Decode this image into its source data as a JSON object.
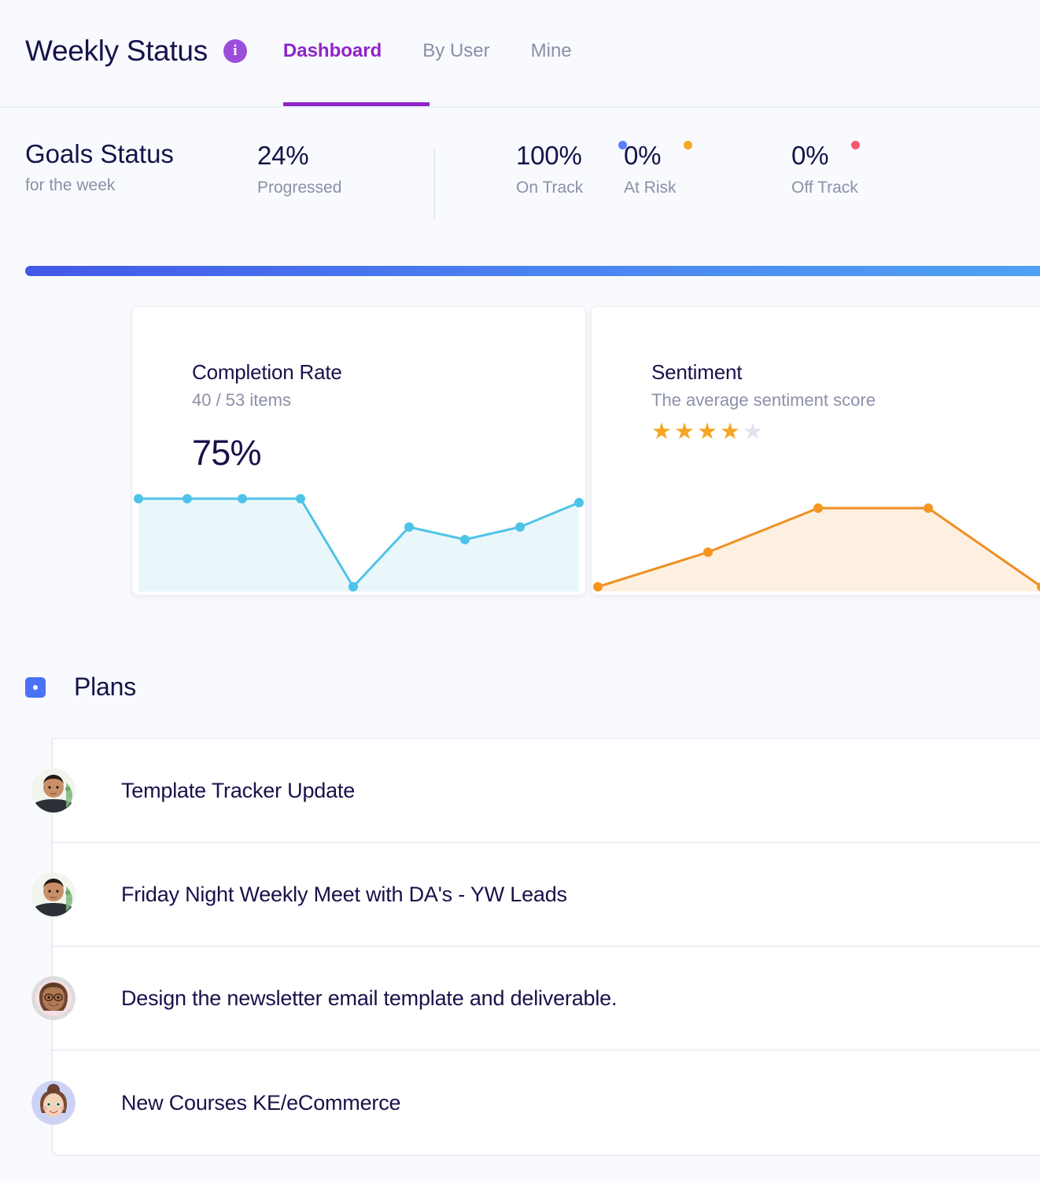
{
  "header": {
    "title": "Weekly Status",
    "info_icon": "info-icon",
    "tabs": [
      {
        "label": "Dashboard",
        "active": true
      },
      {
        "label": "By User",
        "active": false
      },
      {
        "label": "Mine",
        "active": false
      }
    ],
    "active_tab_color": "#8e24c9"
  },
  "goals": {
    "title": "Goals Status",
    "subtitle": "for the week",
    "metrics": [
      {
        "value": "24%",
        "label": "Progressed",
        "dot": null
      },
      {
        "value": "100%",
        "label": "On Track",
        "dot": "#5b7cfa"
      },
      {
        "value": "0%",
        "label": "At Risk",
        "dot": "#f5a623"
      },
      {
        "value": "0%",
        "label": "Off Track",
        "dot": "#f8586f"
      }
    ]
  },
  "progress_bar": {
    "gradient_from": "#4358e8",
    "gradient_to": "#4fa2f3",
    "percent": 100
  },
  "cards": {
    "completion": {
      "title": "Completion Rate",
      "subtitle": "40 / 53 items",
      "value": "75%",
      "line_color": "#4ec3e8",
      "fill_color": "#e9f7fb"
    },
    "sentiment": {
      "title": "Sentiment",
      "subtitle": "The average sentiment score",
      "stars_filled": 4,
      "stars_total": 5,
      "star_on_color": "#f5a623",
      "star_off_color": "#e2e3ef",
      "line_color": "#ef8f22",
      "fill_color": "#fdf0e0"
    }
  },
  "plans": {
    "section_icon": "plans-square-icon",
    "section_title": "Plans",
    "items": [
      {
        "text": "Template Tracker Update",
        "avatar": "avatar-photo-man"
      },
      {
        "text": "Friday Night Weekly Meet with DA's - YW Leads",
        "avatar": "avatar-photo-man"
      },
      {
        "text": "Design the newsletter email template and deliverable.",
        "avatar": "avatar-illustration-woman-glasses"
      },
      {
        "text": "New Courses KE/eCommerce",
        "avatar": "avatar-illustration-woman-bun"
      }
    ]
  },
  "chart_data": [
    {
      "type": "area",
      "title": "Completion Rate",
      "x": [
        0,
        1,
        2,
        3,
        4,
        5,
        6,
        7,
        8
      ],
      "values": [
        100,
        100,
        100,
        100,
        0,
        72,
        60,
        68,
        88
      ],
      "ylim": [
        0,
        100
      ],
      "xlabel": "",
      "ylabel": "",
      "legend": "none",
      "grid": false,
      "line_color": "#4ec3e8",
      "fill_color": "#e9f7fb",
      "summary_value": "75%",
      "summary_items": "40 / 53 items"
    },
    {
      "type": "area",
      "title": "Sentiment",
      "x": [
        0,
        1,
        2,
        3,
        4
      ],
      "values": [
        0,
        54,
        100,
        100,
        0
      ],
      "ylim": [
        0,
        100
      ],
      "xlabel": "",
      "ylabel": "",
      "legend": "none",
      "grid": false,
      "line_color": "#ef8f22",
      "fill_color": "#fdf0e0",
      "rating": 4,
      "rating_max": 5
    }
  ]
}
